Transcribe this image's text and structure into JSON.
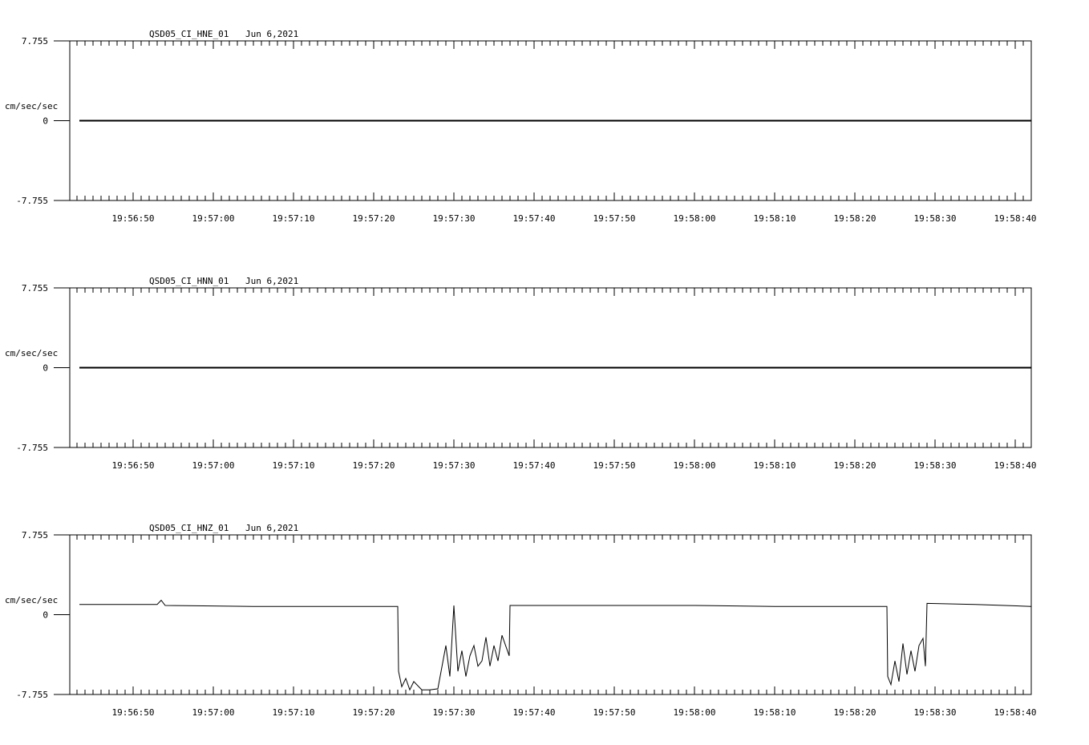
{
  "chart_data": [
    {
      "type": "line",
      "title": "QSD05_CI_HNE_01",
      "date": "Jun 6,2021",
      "ylabel": "cm/sec/sec",
      "ylim": [
        -7.755,
        7.755
      ],
      "yticks": [
        "7.755",
        "0",
        "-7.755"
      ],
      "xticks": [
        "19:56:50",
        "19:57:00",
        "19:57:10",
        "19:57:20",
        "19:57:30",
        "19:57:40",
        "19:57:50",
        "19:58:00",
        "19:58:10",
        "19:58:20",
        "19:58:30",
        "19:58:40"
      ],
      "grid": false,
      "series": [
        {
          "x": [
            "19:56:43",
            "19:58:42"
          ],
          "values": [
            0,
            0
          ]
        }
      ]
    },
    {
      "type": "line",
      "title": "QSD05_CI_HNN_01",
      "date": "Jun 6,2021",
      "ylabel": "cm/sec/sec",
      "ylim": [
        -7.755,
        7.755
      ],
      "yticks": [
        "7.755",
        "0",
        "-7.755"
      ],
      "xticks": [
        "19:56:50",
        "19:57:00",
        "19:57:10",
        "19:57:20",
        "19:57:30",
        "19:57:40",
        "19:57:50",
        "19:58:00",
        "19:58:10",
        "19:58:20",
        "19:58:30",
        "19:58:40"
      ],
      "grid": false,
      "series": [
        {
          "x": [
            "19:56:43",
            "19:58:42"
          ],
          "values": [
            0,
            0
          ]
        }
      ]
    },
    {
      "type": "line",
      "title": "QSD05_CI_HNZ_01",
      "date": "Jun 6,2021",
      "ylabel": "cm/sec/sec",
      "ylim": [
        -7.755,
        7.755
      ],
      "yticks": [
        "7.755",
        "0",
        "-7.755"
      ],
      "xticks": [
        "19:56:50",
        "19:57:00",
        "19:57:10",
        "19:57:20",
        "19:57:30",
        "19:57:40",
        "19:57:50",
        "19:58:00",
        "19:58:10",
        "19:58:20",
        "19:58:30",
        "19:58:40"
      ],
      "grid": false,
      "series": [
        {
          "x": [
            "19:56:43",
            "19:56:53",
            "19:56:53.5",
            "19:56:54",
            "19:57:05",
            "19:57:15",
            "19:57:23",
            "19:57:23.1",
            "19:57:23.5",
            "19:57:24",
            "19:57:24.5",
            "19:57:25",
            "19:57:26",
            "19:57:27",
            "19:57:28",
            "19:57:29",
            "19:57:29.5",
            "19:57:30",
            "19:57:30.5",
            "19:57:31",
            "19:57:31.5",
            "19:57:32",
            "19:57:32.5",
            "19:57:33",
            "19:57:33.5",
            "19:57:34",
            "19:57:34.5",
            "19:57:35",
            "19:57:35.5",
            "19:57:36",
            "19:57:36.9",
            "19:57:37",
            "19:57:50",
            "19:58:00",
            "19:58:10",
            "19:58:20",
            "19:58:24",
            "19:58:24.1",
            "19:58:24.5",
            "19:58:25",
            "19:58:25.5",
            "19:58:26",
            "19:58:26.5",
            "19:58:27",
            "19:58:27.5",
            "19:58:28",
            "19:58:28.5",
            "19:58:28.8",
            "19:58:29",
            "19:58:35",
            "19:58:42"
          ],
          "values": [
            1.0,
            1.0,
            1.4,
            0.9,
            0.8,
            0.8,
            0.8,
            -5.5,
            -7.0,
            -6.2,
            -7.3,
            -6.5,
            -7.3,
            -7.3,
            -7.2,
            -3.0,
            -6.0,
            0.9,
            -5.5,
            -3.5,
            -6.0,
            -4.0,
            -3.0,
            -5.0,
            -4.5,
            -2.2,
            -5.0,
            -3.0,
            -4.5,
            -2.0,
            -4.0,
            0.9,
            0.9,
            0.9,
            0.8,
            0.8,
            0.8,
            -6.0,
            -6.8,
            -4.5,
            -6.5,
            -2.8,
            -5.8,
            -3.5,
            -5.5,
            -3.0,
            -2.3,
            -5.0,
            1.1,
            1.0,
            0.8
          ]
        }
      ]
    }
  ]
}
